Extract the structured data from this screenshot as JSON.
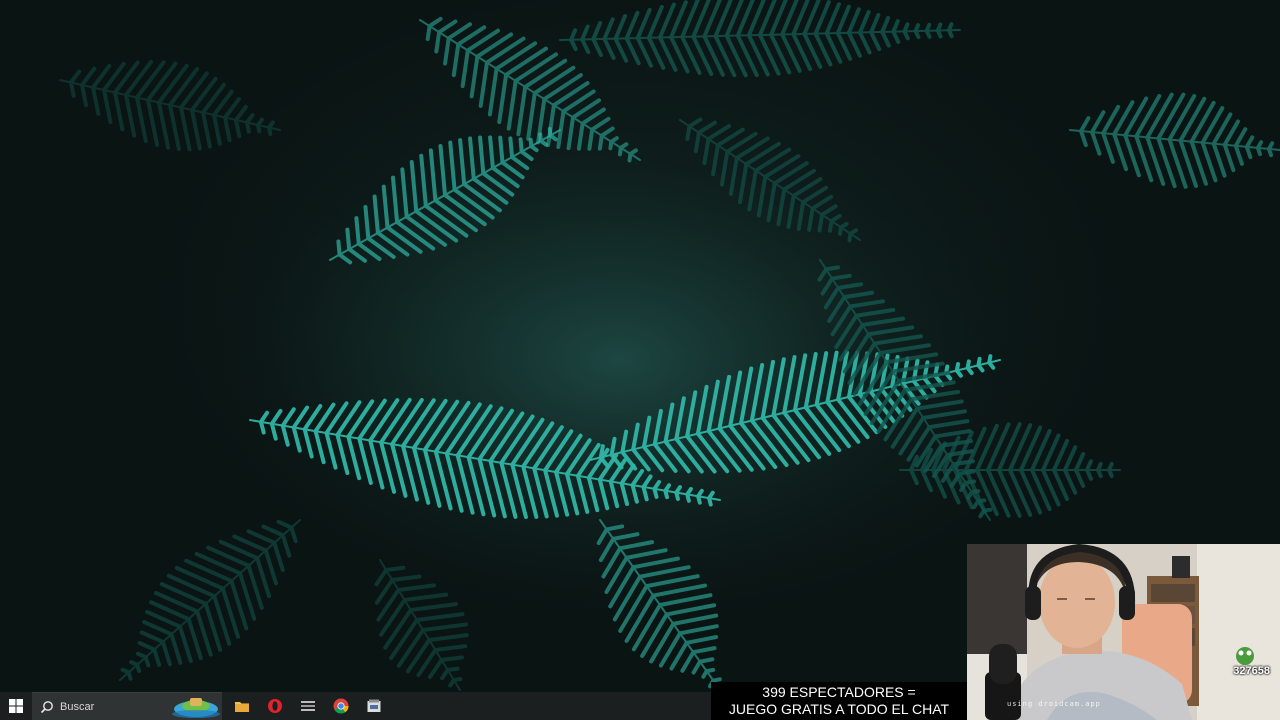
{
  "taskbar": {
    "search_placeholder": "Buscar",
    "pinned_apps": [
      "file-explorer",
      "opera",
      "app",
      "chrome",
      "app"
    ]
  },
  "overlay": {
    "caption_line1": "399 ESPECTADORES =",
    "caption_line2": "JUEGO GRATIS A TODO EL CHAT"
  },
  "webcam": {
    "watermark": "using droidcam.app",
    "counter": "327658"
  },
  "colors": {
    "fern": "#2fb5a5",
    "fern_dark": "#14564f",
    "taskbar": "#1b1f1f",
    "search_box": "#2f3333"
  }
}
